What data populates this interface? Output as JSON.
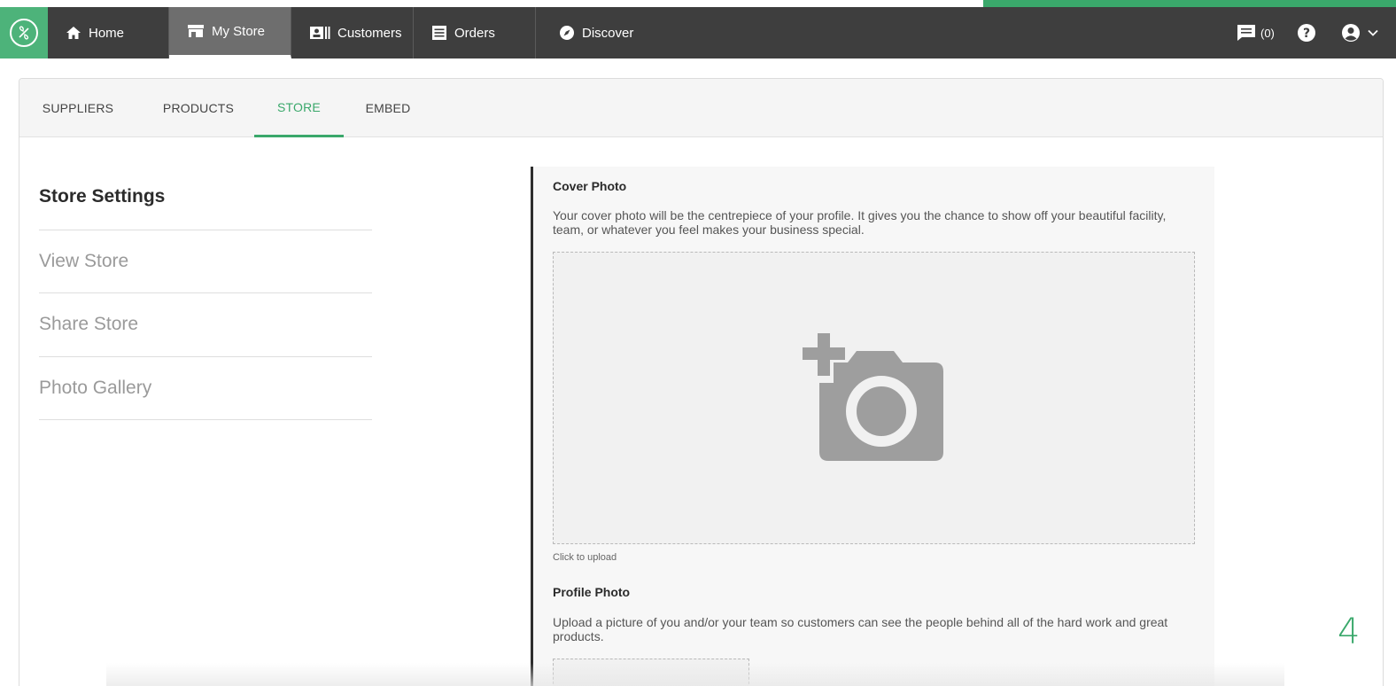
{
  "nav": {
    "logo": "leaf-logo-icon",
    "items": [
      {
        "label": "Home",
        "icon": "home-icon"
      },
      {
        "label": "My Store",
        "icon": "store-icon"
      },
      {
        "label": "Customers",
        "icon": "contacts-icon"
      },
      {
        "label": "Orders",
        "icon": "list-icon"
      },
      {
        "label": "Discover",
        "icon": "compass-icon"
      }
    ],
    "messages_count": "(0)",
    "active_item": "My Store"
  },
  "tabs": [
    {
      "label": "SUPPLIERS"
    },
    {
      "label": "PRODUCTS"
    },
    {
      "label": "STORE"
    },
    {
      "label": "EMBED"
    }
  ],
  "active_tab": "STORE",
  "sidebar": {
    "title": "Store Settings",
    "items": [
      {
        "label": "View Store"
      },
      {
        "label": "Share Store"
      },
      {
        "label": "Photo Gallery"
      }
    ]
  },
  "cover_photo": {
    "title": "Cover Photo",
    "description": "Your cover photo will be the centrepiece of your profile. It gives you the chance to show off your beautiful facility, team, or whatever you feel makes your business special.",
    "upload_hint": "Click to upload",
    "icon": "add-photo-icon"
  },
  "profile_photo": {
    "title": "Profile Photo",
    "description": "Upload a picture of you and/or your team so customers can see the people behind all of the hard work and great products."
  },
  "page_number": "4",
  "colors": {
    "accent": "#3aa86b",
    "navbar": "#3e3e3e",
    "nav_active": "#6e6e6e"
  }
}
